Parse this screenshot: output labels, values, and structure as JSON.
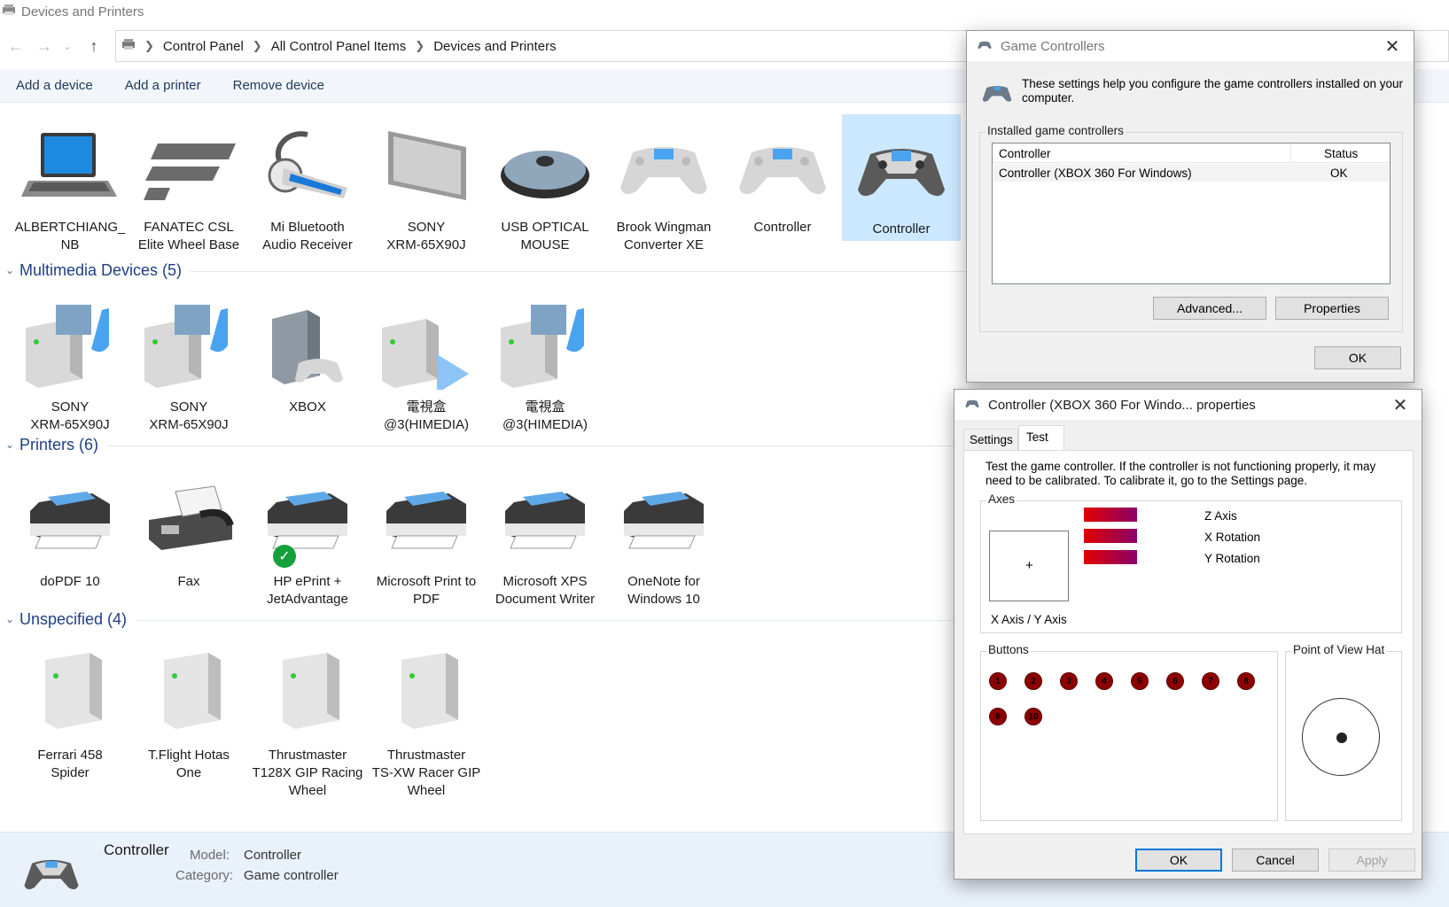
{
  "window": {
    "title": "Devices and Printers"
  },
  "breadcrumb": [
    "Control Panel",
    "All Control Panel Items",
    "Devices and Printers"
  ],
  "commands": {
    "add_device": "Add a device",
    "add_printer": "Add a printer",
    "remove_device": "Remove device"
  },
  "groups": {
    "devices": {
      "items": [
        {
          "label": "ALBERTCHIANG_\nNB",
          "icon": "laptop-icon"
        },
        {
          "label": "FANATEC CSL\nElite Wheel Base",
          "icon": "fanatec-logo-icon"
        },
        {
          "label": "Mi Bluetooth\nAudio Receiver",
          "icon": "bluetooth-headset-icon"
        },
        {
          "label": "SONY\nXRM-65X90J",
          "icon": "monitor-icon"
        },
        {
          "label": "USB OPTICAL\nMOUSE",
          "icon": "mouse-icon"
        },
        {
          "label": "Brook Wingman\nConverter XE",
          "icon": "gamepad-icon"
        },
        {
          "label": "Controller",
          "icon": "gamepad-icon"
        },
        {
          "label": "Controller",
          "icon": "gamepad-icon",
          "selected": true
        }
      ]
    },
    "multimedia": {
      "title": "Multimedia Devices (5)",
      "items": [
        {
          "label": "SONY\nXRM-65X90J",
          "icon": "media-server-icon"
        },
        {
          "label": "SONY\nXRM-65X90J",
          "icon": "media-server-icon"
        },
        {
          "label": "XBOX",
          "icon": "xbox-console-icon"
        },
        {
          "label": "電視盒\n@3(HIMEDIA)",
          "icon": "media-renderer-icon"
        },
        {
          "label": "電視盒\n@3(HIMEDIA)",
          "icon": "media-server-icon"
        }
      ]
    },
    "printers": {
      "title": "Printers (6)",
      "items": [
        {
          "label": "doPDF 10",
          "icon": "printer-icon"
        },
        {
          "label": "Fax",
          "icon": "fax-icon"
        },
        {
          "label": "HP ePrint +\nJetAdvantage",
          "icon": "printer-default-icon"
        },
        {
          "label": "Microsoft Print to\nPDF",
          "icon": "printer-icon"
        },
        {
          "label": "Microsoft XPS\nDocument Writer",
          "icon": "printer-icon"
        },
        {
          "label": "OneNote for\nWindows 10",
          "icon": "printer-icon"
        }
      ]
    },
    "unspecified": {
      "title": "Unspecified (4)",
      "items": [
        {
          "label": "Ferrari 458\nSpider",
          "icon": "tower-device-icon"
        },
        {
          "label": "T.Flight Hotas\nOne",
          "icon": "tower-device-icon"
        },
        {
          "label": "Thrustmaster\nT128X GIP Racing\nWheel",
          "icon": "tower-device-icon"
        },
        {
          "label": "Thrustmaster\nTS-XW Racer GIP\nWheel",
          "icon": "tower-device-icon"
        }
      ]
    }
  },
  "details": {
    "name": "Controller",
    "model_label": "Model:",
    "model_value": "Controller",
    "category_label": "Category:",
    "category_value": "Game controller"
  },
  "game_controllers_dialog": {
    "title": "Game Controllers",
    "intro": "These settings help you configure the game controllers installed on your computer.",
    "group_label": "Installed game controllers",
    "columns": [
      "Controller",
      "Status"
    ],
    "rows": [
      {
        "controller": "Controller (XBOX 360 For Windows)",
        "status": "OK"
      }
    ],
    "advanced": "Advanced...",
    "properties": "Properties",
    "ok": "OK"
  },
  "properties_dialog": {
    "title": "Controller (XBOX 360 For Windo... properties",
    "tabs": [
      "Settings",
      "Test"
    ],
    "active_tab": "Test",
    "instructions": "Test the game controller.  If the controller is not functioning properly, it may need to be calibrated.  To calibrate it, go to the Settings page.",
    "axes_label": "Axes",
    "xy_label": "X Axis / Y Axis",
    "crosshair": "+",
    "axis_labels": [
      "Z Axis",
      "X Rotation",
      "Y Rotation"
    ],
    "buttons_label": "Buttons",
    "buttons": [
      "1",
      "2",
      "3",
      "4",
      "5",
      "6",
      "7",
      "8",
      "9",
      "10"
    ],
    "pov_label": "Point of View Hat",
    "ok": "OK",
    "cancel": "Cancel",
    "apply": "Apply"
  },
  "colors": {
    "group_header": "#1e3f84",
    "selection": "#cce8ff",
    "button_indicator": "#8e0000",
    "default_button_border": "#0078d7"
  }
}
